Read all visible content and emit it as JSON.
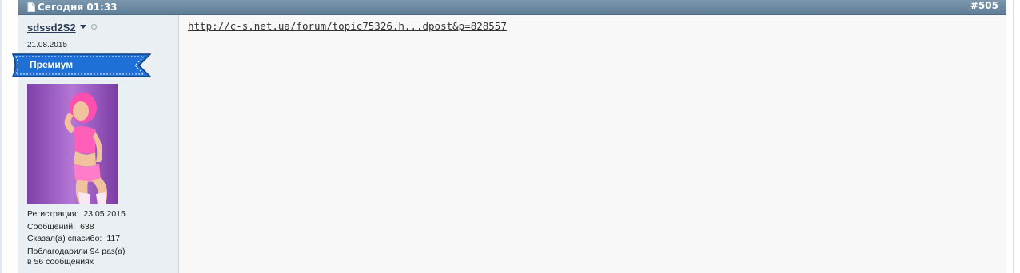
{
  "post": {
    "date": "Сегодня 01:33",
    "number": "#505"
  },
  "user": {
    "name": "sdssd2S2",
    "date": "21.08.2015",
    "rank": "Премиум",
    "stats": {
      "registration_label": "Регистрация:",
      "registration_value": "23.05.2015",
      "messages_label": "Сообщений:",
      "messages_value": "638",
      "thanks_label": "Сказал(а) спасибо:",
      "thanks_value": "117",
      "thanked_line1": "Поблагодарили 94 раз(а)",
      "thanked_line2": "в 56 сообщениях"
    }
  },
  "content": {
    "link": "http://c-s.net.ua/forum/topic75326.h...dpost&p=828557"
  },
  "colors": {
    "header": "#6a879f",
    "ribbon": "#1e6fd6",
    "sidebar": "#e9eff3",
    "body": "#f8f8f8"
  }
}
